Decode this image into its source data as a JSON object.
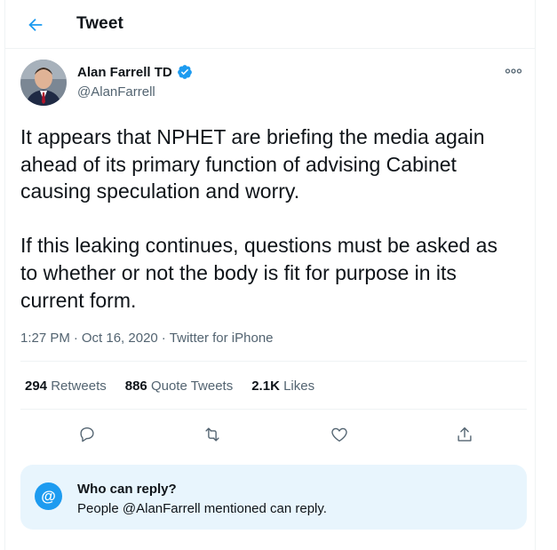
{
  "header": {
    "title": "Tweet",
    "back_icon": "arrow-left-icon"
  },
  "author": {
    "display_name": "Alan Farrell TD",
    "handle": "@AlanFarrell",
    "verified_icon": "verified-badge-icon"
  },
  "tweet": {
    "text": "It appears that NPHET are briefing the media again\nahead of its primary function of advising Cabinet\ncausing speculation and worry.\n\nIf this leaking continues, questions must be asked as\nto whether or not the body is fit for purpose in its\ncurrent form.",
    "time": "1:27 PM",
    "date": "Oct 16, 2020",
    "source": "Twitter for iPhone",
    "separator": "·"
  },
  "stats": {
    "retweets_count": "294",
    "retweets_label": "Retweets",
    "quotes_count": "886",
    "quotes_label": "Quote Tweets",
    "likes_count": "2.1K",
    "likes_label": "Likes"
  },
  "actions": [
    "reply-icon",
    "retweet-icon",
    "like-icon",
    "share-icon"
  ],
  "reply_restriction": {
    "icon_glyph": "@",
    "title": "Who can reply?",
    "description": "People @AlanFarrell mentioned can reply."
  },
  "colors": {
    "accent": "#1d9bf0",
    "secondary_text": "#536471",
    "reply_box_bg": "#e8f5fd"
  }
}
